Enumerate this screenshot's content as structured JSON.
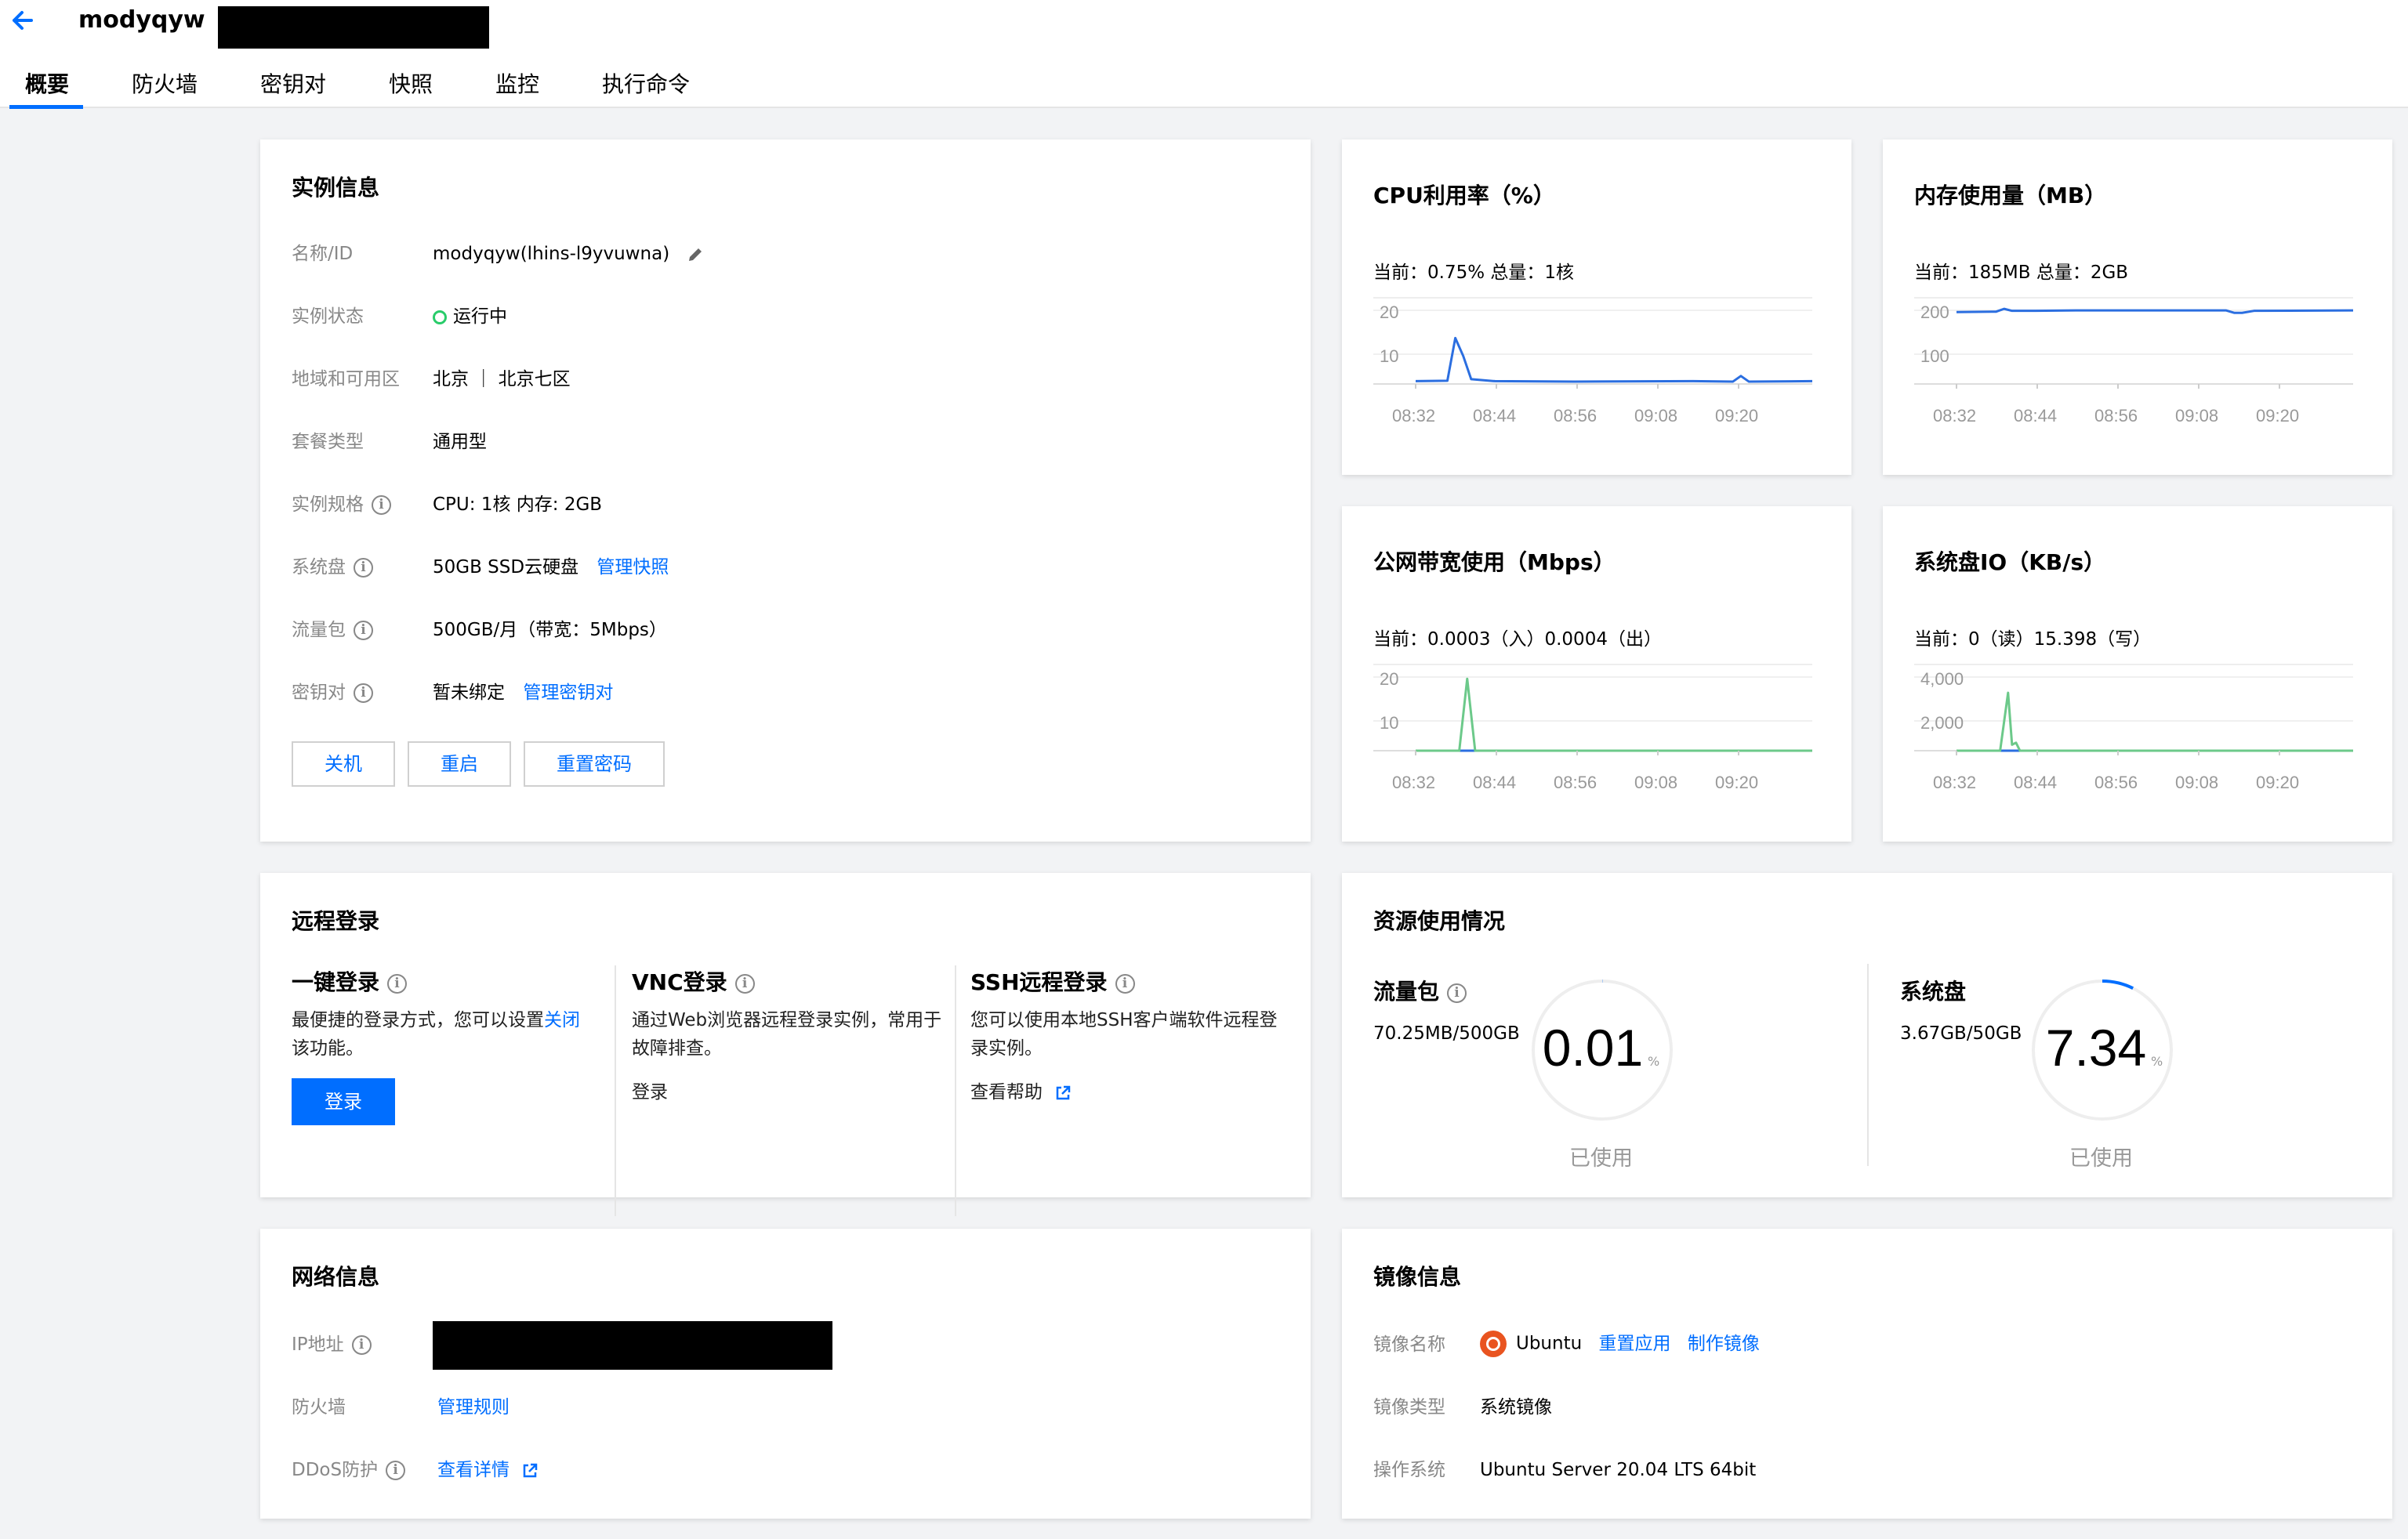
{
  "header": {
    "instance_name": "modyqyw",
    "tabs": [
      "概要",
      "防火墙",
      "密钥对",
      "快照",
      "监控",
      "执行命令"
    ]
  },
  "instance_info": {
    "title": "实例信息",
    "rows": [
      {
        "label": "名称/ID",
        "value": "modyqyw(lhins-l9yvuwna)"
      },
      {
        "label": "实例状态",
        "value": "运行中"
      },
      {
        "label": "地域和可用区",
        "value": "北京 ｜ 北京七区"
      },
      {
        "label": "套餐类型",
        "value": "通用型"
      },
      {
        "label": "实例规格",
        "value": "CPU: 1核 内存: 2GB"
      },
      {
        "label": "系统盘",
        "value": "50GB SSD云硬盘",
        "link": "管理快照"
      },
      {
        "label": "流量包",
        "value": "500GB/月（带宽：5Mbps）"
      },
      {
        "label": "密钥对",
        "value": "暂未绑定",
        "link": "管理密钥对"
      }
    ],
    "buttons": {
      "shutdown": "关机",
      "restart": "重启",
      "reset_password": "重置密码"
    }
  },
  "monitor_cards": [
    {
      "title": "CPU利用率（%）",
      "current": "当前：0.75% 总量：1核"
    },
    {
      "title": "内存使用量（MB）",
      "current": "当前：185MB 总量：2GB"
    },
    {
      "title": "公网带宽使用（Mbps）",
      "current": "当前：0.0003（入）0.0004（出）"
    },
    {
      "title": "系统盘IO（KB/s）",
      "current": "当前：0（读）15.398（写）"
    }
  ],
  "chart_data": [
    {
      "type": "line",
      "title": "CPU利用率（%）",
      "x_ticks": [
        "08:32",
        "08:44",
        "08:56",
        "09:08",
        "09:20"
      ],
      "y_ticks": [
        "20",
        "10"
      ],
      "ylim": [
        0,
        20
      ],
      "series": [
        {
          "color": "#2b6ee0",
          "x": [
            0,
            8,
            10,
            12,
            14,
            20,
            40,
            70,
            80,
            82,
            84,
            100
          ],
          "y": [
            0.7,
            0.8,
            11.5,
            7,
            1.2,
            0.7,
            0.6,
            0.7,
            0.6,
            2.0,
            0.6,
            0.7
          ]
        }
      ]
    },
    {
      "type": "line",
      "title": "内存使用量（MB）",
      "x_ticks": [
        "08:32",
        "08:44",
        "08:56",
        "09:08",
        "09:20"
      ],
      "y_ticks": [
        "200",
        "100"
      ],
      "ylim": [
        0,
        200
      ],
      "series": [
        {
          "color": "#2b6ee0",
          "x": [
            0,
            10,
            12,
            14,
            20,
            30,
            50,
            68,
            70,
            72,
            75,
            100
          ],
          "y": [
            180,
            181,
            188,
            183,
            183,
            184,
            184,
            184,
            178,
            178,
            183,
            184
          ]
        }
      ]
    },
    {
      "type": "line",
      "title": "公网带宽使用（Mbps）",
      "x_ticks": [
        "08:32",
        "08:44",
        "08:56",
        "09:08",
        "09:20"
      ],
      "y_ticks": [
        "20",
        "10"
      ],
      "ylim": [
        0,
        20
      ],
      "series": [
        {
          "color": "#2b6ee0",
          "x": [
            0,
            100
          ],
          "y": [
            0,
            0
          ]
        },
        {
          "color": "#6cc98a",
          "x": [
            0,
            11,
            13,
            15,
            100
          ],
          "y": [
            0,
            0,
            18,
            0,
            0
          ]
        }
      ]
    },
    {
      "type": "line",
      "title": "系统盘IO（KB/s）",
      "x_ticks": [
        "08:32",
        "08:44",
        "08:56",
        "09:08",
        "09:20"
      ],
      "y_ticks": [
        "4,000",
        "2,000"
      ],
      "ylim": [
        0,
        4000
      ],
      "series": [
        {
          "color": "#2b6ee0",
          "x": [
            0,
            100
          ],
          "y": [
            0,
            0
          ]
        },
        {
          "color": "#6cc98a",
          "x": [
            0,
            11,
            13,
            14,
            15,
            16,
            100
          ],
          "y": [
            0,
            0,
            2900,
            300,
            400,
            0,
            0
          ]
        }
      ]
    }
  ],
  "remote_login": {
    "title": "远程登录",
    "one_click": {
      "title": "一键登录",
      "desc_pre": "最便捷的登录方式，您可以设置",
      "desc_link": "关闭",
      "desc_post": "该功能。",
      "button": "登录"
    },
    "vnc": {
      "title": "VNC登录",
      "desc": "通过Web浏览器远程登录实例，常用于故障排查。",
      "link": "登录"
    },
    "ssh": {
      "title": "SSH远程登录",
      "desc": "您可以使用本地SSH客户端软件远程登录实例。",
      "link": "查看帮助"
    }
  },
  "resource_usage": {
    "title": "资源使用情况",
    "traffic": {
      "title": "流量包",
      "amount": "70.25MB/500GB",
      "percent": "0.01",
      "unit": "%",
      "used_label": "已使用",
      "fraction": 0.0001
    },
    "disk": {
      "title": "系统盘",
      "amount": "3.67GB/50GB",
      "percent": "7.34",
      "unit": "%",
      "used_label": "已使用",
      "fraction": 0.0734
    }
  },
  "network_info": {
    "title": "网络信息",
    "ip_label": "IP地址",
    "firewall_label": "防火墙",
    "firewall_link": "管理规则",
    "ddos_label": "DDoS防护",
    "ddos_link": "查看详情"
  },
  "image_info": {
    "title": "镜像信息",
    "name_label": "镜像名称",
    "name_value": "Ubuntu",
    "reapply_link": "重置应用",
    "make_image_link": "制作镜像",
    "type_label": "镜像类型",
    "type_value": "系统镜像",
    "os_label": "操作系统",
    "os_value": "Ubuntu Server 20.04 LTS 64bit"
  },
  "colors": {
    "accent": "#006eff",
    "running": "#29cc6a",
    "chart_blue": "#2b6ee0",
    "chart_green": "#6cc98a",
    "ubuntu": "#e95420"
  }
}
